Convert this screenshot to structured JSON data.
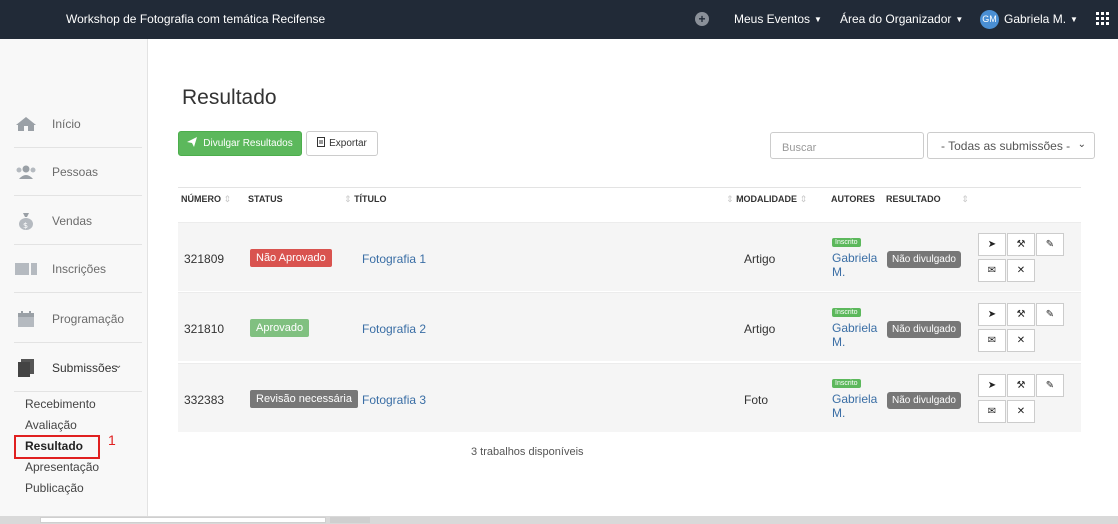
{
  "topbar": {
    "title": "Workshop de Fotografia com temática Recifense",
    "meus_eventos": "Meus Eventos",
    "area_organizador": "Área do Organizador",
    "avatar_initials": "GM",
    "user_name": "Gabriela M."
  },
  "sidebar": {
    "items": [
      {
        "label": "Início",
        "icon": "home-icon"
      },
      {
        "label": "Pessoas",
        "icon": "people-icon"
      },
      {
        "label": "Vendas",
        "icon": "money-bag-icon"
      },
      {
        "label": "Inscrições",
        "icon": "ticket-icon"
      },
      {
        "label": "Programação",
        "icon": "calendar-icon"
      },
      {
        "label": "Submissões",
        "icon": "document-icon"
      }
    ],
    "submenu": [
      "Recebimento",
      "Avaliação",
      "Resultado",
      "Apresentação",
      "Publicação"
    ],
    "annotation_number": "1"
  },
  "main": {
    "title": "Resultado",
    "btn_divulgar": "Divulgar Resultados",
    "btn_exportar": "Exportar",
    "search_placeholder": "Buscar",
    "filter_selected": "- Todas as submissões -",
    "columns": {
      "numero": "NÚMERO",
      "status": "STATUS",
      "titulo": "TÍTULO",
      "modalidade": "MODALIDADE",
      "autores": "AUTORES",
      "resultado": "RESULTADO"
    },
    "rows": [
      {
        "numero": "321809",
        "status": "Não Aprovado",
        "titulo": "Fotografia 1",
        "modalidade": "Artigo",
        "tag": "Inscrito",
        "autor1": "Gabriela",
        "autor2": "M.",
        "resultado": "Não divulgado"
      },
      {
        "numero": "321810",
        "status": "Aprovado",
        "titulo": "Fotografia 2",
        "modalidade": "Artigo",
        "tag": "Inscrito",
        "autor1": "Gabriela",
        "autor2": "M.",
        "resultado": "Não divulgado"
      },
      {
        "numero": "332383",
        "status": "Revisão necessária",
        "titulo": "Fotografia 3",
        "modalidade": "Foto",
        "tag": "Inscrito",
        "autor1": "Gabriela",
        "autor2": "M.",
        "resultado": "Não divulgado"
      }
    ],
    "footer": "3 trabalhos disponíveis"
  },
  "colors": {
    "topbar_bg": "#212a37",
    "green": "#5cb85c",
    "red": "#d9534f",
    "light_green": "#80c080",
    "gray": "#777777",
    "link": "#3a6ea5",
    "annotation_red": "#e02020"
  }
}
